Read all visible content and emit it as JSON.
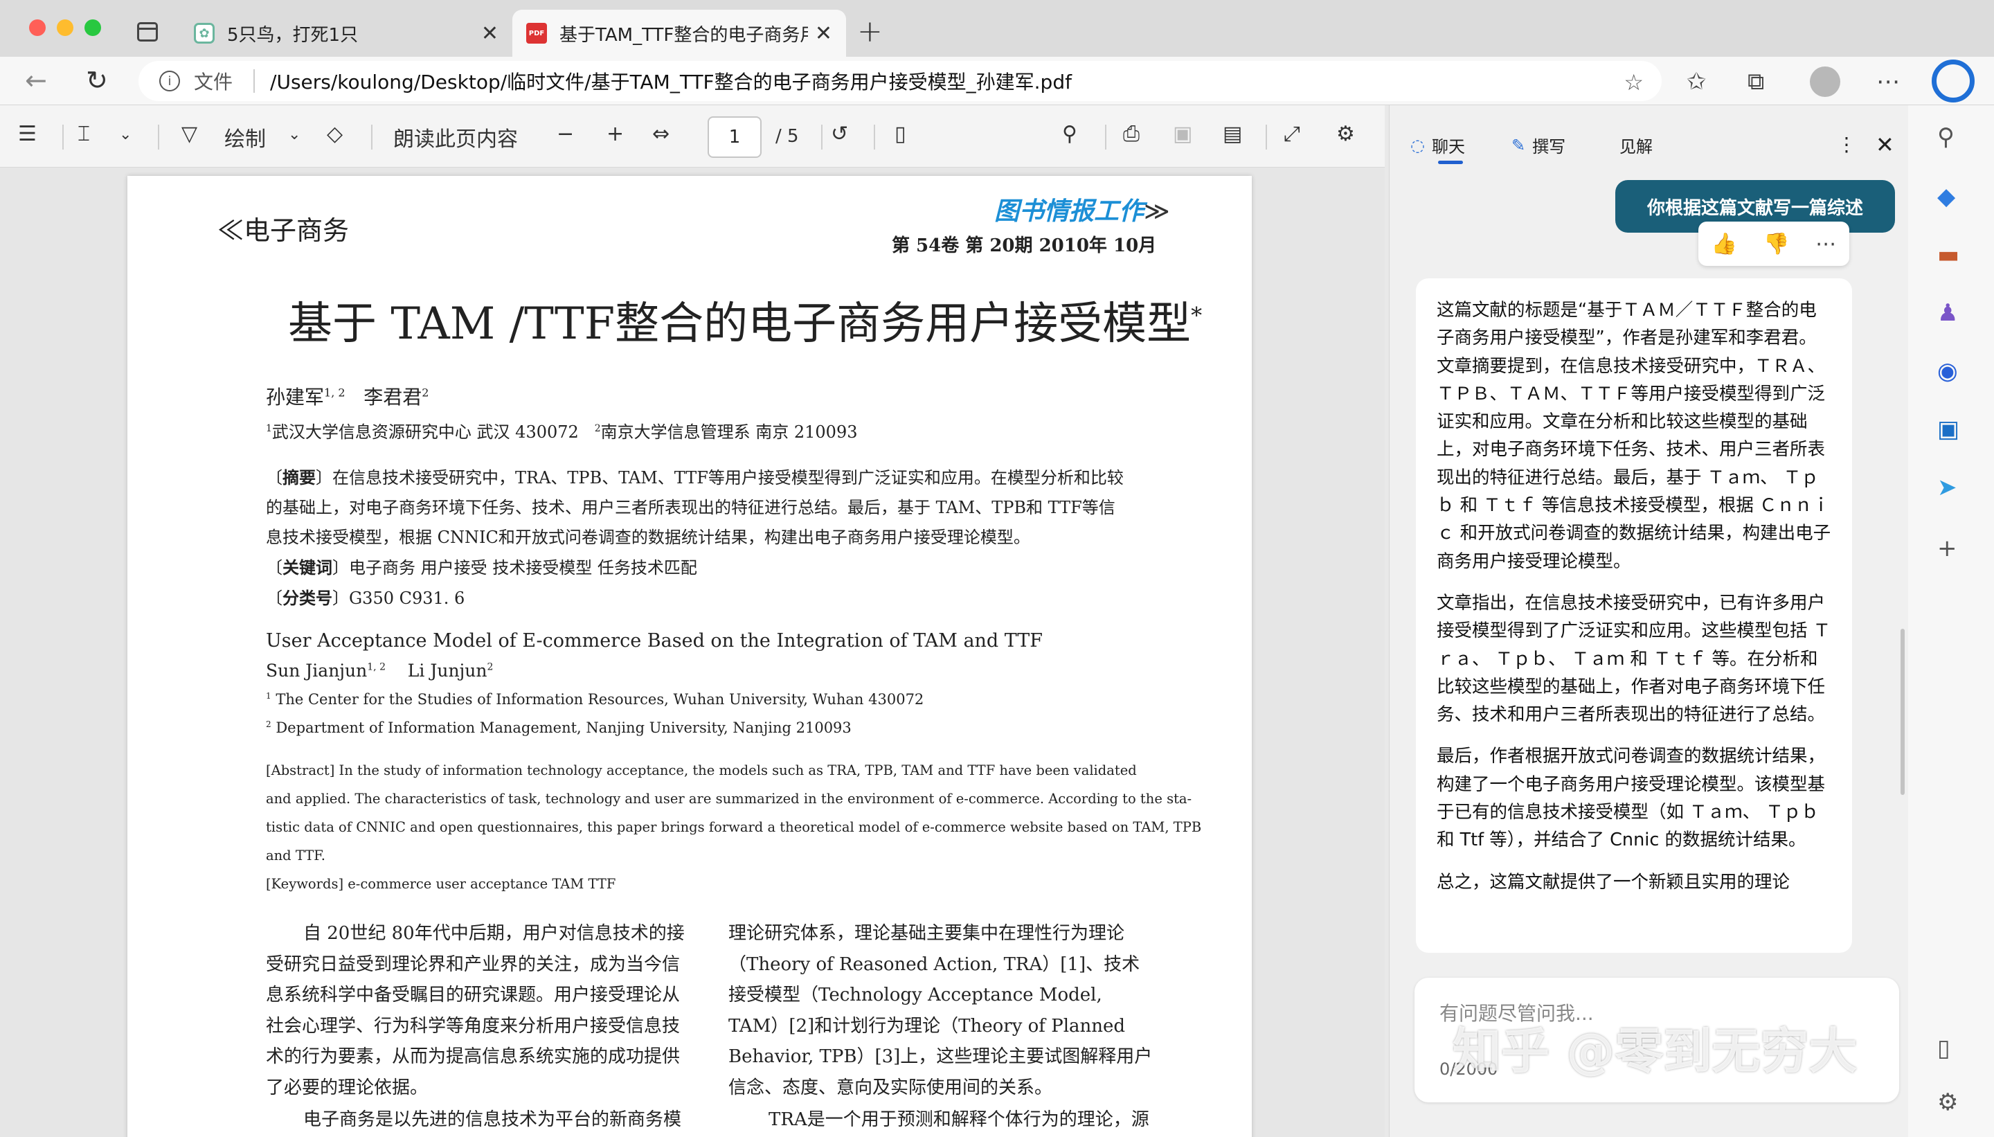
{
  "tabs": [
    {
      "label": "5只鸟，打死1只",
      "icon": "chatgpt-icon"
    },
    {
      "label": "基于TAM_TTF整合的电子商务用",
      "icon": "pdf-icon"
    }
  ],
  "address": {
    "scheme": "文件",
    "url": "/Users/koulong/Desktop/临时文件/基于TAM_TTF整合的电子商务用户接受模型_孙建军.pdf"
  },
  "pdf_toolbar": {
    "draw_label": "绘制",
    "read_aloud_label": "朗读此页内容",
    "page_current": "1",
    "page_total": "/ 5"
  },
  "paper": {
    "section_left": "电子商务",
    "journal_mark": "图书情报工作",
    "issue": "第 54卷 第 20期   2010年 10月",
    "title": "基于 TAM /TTF整合的电子商务用户接受模型",
    "title_star": "*",
    "authors": "孙建军",
    "author1_sup": "1, 2",
    "author2": "李君君",
    "author2_sup": "2",
    "affil_sup1": "1",
    "affil1": "武汉大学信息资源研究中心   武汉  430072",
    "affil_sup2": "2",
    "affil2": "南京大学信息管理系   南京  210093",
    "abstract_label": "摘要",
    "abstract_lines": [
      "在信息技术接受研究中，TRA、TPB、TAM、TTF等用户接受模型得到广泛证实和应用。在模型分析和比较",
      "的基础上，对电子商务环境下任务、技术、用户三者所表现出的特征进行总结。最后，基于 TAM、TPB和 TTF等信",
      "息技术接受模型，根据 CNNIC和开放式问卷调查的数据统计结果，构建出电子商务用户接受理论模型。"
    ],
    "keywords_label": "关键词",
    "keywords": "电子商务   用户接受   技术接受模型   任务技术匹配",
    "class_label": "分类号",
    "class_no": "G350   C931. 6",
    "en_title": "User Acceptance Model of E-commerce Based on the Integration of TAM and TTF",
    "en_authors": "Sun Jianjun",
    "en_author1_sup": "1, 2",
    "en_author2": "Li Junjun",
    "en_author2_sup": "2",
    "en_affil1": "The Center for the Studies of Information Resources, Wuhan University, Wuhan 430072",
    "en_affil2": "Department of Information Management, Nanjing University, Nanjing 210093",
    "en_abstract_lines": [
      "[Abstract] In the study of information technology acceptance, the models such as TRA, TPB, TAM and TTF have been validated",
      "and applied. The characteristics of task, technology and user are summarized in the environment of e-commerce. According to the sta-",
      "tistic data of CNNIC and open questionnaires, this paper brings forward a theoretical model of e-commerce website based on TAM, TPB",
      "and TTF."
    ],
    "en_keywords": "[Keywords] e-commerce   user acceptance   TAM   TTF",
    "col1": "自 20世纪 80年代中后期，用户对信息技术的接受研究日益受到理论界和产业界的关注，成为当今信息系统科学中备受瞩目的研究课题。用户接受理论从社会心理学、行为科学等角度来分析用户接受信息技术的行为要素，从而为提高信息系统实施的成功提供了必要的理论依据。",
    "col1_next": "电子商务是以先进的信息技术为平台的新商务模",
    "col2": "理论研究体系，理论基础主要集中在理性行为理论（Theory of Reasoned Action, TRA）[1]、技术接受模型（Technology Acceptance Model, TAM）[2]和计划行为理论（Theory of Planned Behavior, TPB）[3]上，这些理论主要试图解释用户信念、态度、意向及实际使用间的关系。",
    "col2_next": "TRA是一个用于预测和解释个体行为的理论，源"
  },
  "copilot": {
    "tab_chat": "聊天",
    "tab_compose": "撰写",
    "tab_insights": "见解",
    "user_message": "你根据这篇文献写一篇综述",
    "answer_paragraphs": [
      "这篇文献的标题是“基于ＴＡＭ／ＴＴＦ整合的电子商务用户接受模型”，作者是孙建军和李君君。文章摘要提到，在信息技术接受研究中，ＴＲＡ、ＴＰＢ、ＴＡＭ、ＴＴＦ等用户接受模型得到广泛证实和应用。文章在分析和比较这些模型的基础上，对电子商务环境下任务、技术、用户三者所表现出的特征进行总结。最后，基于 Ｔａｍ、 Ｔｐｂ 和 Ｔｔｆ 等信息技术接受模型，根据 Ｃｎｎｉｃ 和开放式问卷调查的数据统计结果，构建出电子商务用户接受理论模型。",
      "文章指出，在信息技术接受研究中，已有许多用户接受模型得到了广泛证实和应用。这些模型包括 Ｔｒａ、 Ｔｐｂ、 Ｔａｍ 和 Ｔｔｆ 等。在分析和比较这些模型的基础上，作者对电子商务环境下任务、技术和用户三者所表现出的特征进行了总结。",
      "最后，作者根据开放式问卷调查的数据统计结果，构建了一个电子商务用户接受理论模型。该模型基于已有的信息技术接受模型（如 Ｔａｍ、 Ｔｐｂ 和 Ttf 等），并结合了 Cnnic 的数据统计结果。",
      "总之，这篇文献提供了一个新颖且实用的理论"
    ],
    "input_placeholder": "有问题尽管问我...",
    "char_count": "0/2000"
  },
  "watermark": "知乎 @零到无穷大",
  "colors": {
    "accent_blue": "#1f5fcf",
    "user_bubble": "#1a5f79",
    "journal_mark": "#1c8fd6"
  }
}
